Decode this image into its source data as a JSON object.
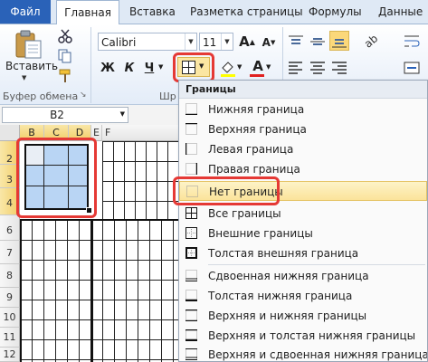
{
  "tabs": {
    "file": "Файл",
    "home": "Главная",
    "insert": "Вставка",
    "page_layout": "Разметка страницы",
    "formulas": "Формулы",
    "data": "Данные"
  },
  "ribbon": {
    "paste_label": "Вставить",
    "clipboard_group": "Буфер обмена",
    "font_group_partial": "Шр",
    "font_name": "Calibri",
    "font_size": "11",
    "grow_font": "A",
    "shrink_font": "A",
    "bold": "Ж",
    "italic": "К",
    "underline": "Ч",
    "font_color_letter": "A"
  },
  "namebox": {
    "value": "B2"
  },
  "grid": {
    "columns": [
      "B",
      "C",
      "D",
      "E",
      "F"
    ],
    "rows": [
      "2",
      "3",
      "4",
      "6",
      "7",
      "8",
      "9",
      "10",
      "11",
      "12"
    ]
  },
  "menu": {
    "header": "Границы",
    "items": [
      "Нижняя граница",
      "Верхняя граница",
      "Левая граница",
      "Правая граница",
      "Нет границы",
      "Все границы",
      "Внешние границы",
      "Толстая внешняя граница",
      "Сдвоенная нижняя граница",
      "Толстая нижняя граница",
      "Верхняя и нижняя границы",
      "Верхняя и толстая нижняя границы",
      "Верхняя и сдвоенная нижняя граница"
    ]
  },
  "colors": {
    "accent": "#2a62b8",
    "highlight": "#e53935",
    "selection": "#b9d5f4"
  }
}
